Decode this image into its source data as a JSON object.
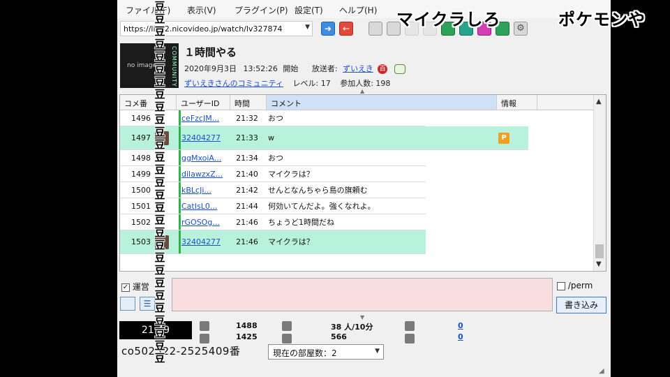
{
  "menu": [
    "ファイル(F)",
    "表示(V)",
    "プラグイン(P)",
    "設定(T)",
    "ヘルプ(H)"
  ],
  "url": "https://live2.nicovideo.jp/watch/lv327874",
  "thumbnail": {
    "text": "no image",
    "side": "COMMUNITY"
  },
  "broadcast": {
    "title": "１時間やる",
    "date": "2020年9月3日",
    "start_time": "13:52:26",
    "start_label": "開始",
    "broadcaster_label": "放送者:",
    "broadcaster": "ずいえき",
    "community": "ずいえきさんのコミュニティ",
    "level": "レベル: 17",
    "participants": "参加人数: 198"
  },
  "table": {
    "headers": [
      "コメ番",
      "ユーザーID",
      "時間",
      "コメント",
      "情報"
    ],
    "rows": [
      {
        "no": "1496",
        "uid": "ceFzcJM...",
        "time": "21:32",
        "comment": "おつ"
      },
      {
        "no": "1497",
        "uid": "32404277",
        "time": "21:33",
        "comment": "w",
        "badge": "P"
      },
      {
        "no": "1498",
        "uid": "ggMxoiA...",
        "time": "21:34",
        "comment": "おつ"
      },
      {
        "no": "1499",
        "uid": "dilawzxZ...",
        "time": "21:40",
        "comment": "マイクラは？"
      },
      {
        "no": "1500",
        "uid": "kBLcJi...",
        "time": "21:42",
        "comment": "せんとなんちゃら島の旗頼む"
      },
      {
        "no": "1501",
        "uid": "CatIsL0...",
        "time": "21:44",
        "comment": "何効いてんだよ。強くなれよ。"
      },
      {
        "no": "1502",
        "uid": "rGOSOg...",
        "time": "21:46",
        "comment": "ちょうど1時間だね"
      },
      {
        "no": "1503",
        "uid": "32404277",
        "time": "21:46",
        "comment": "マイクラは？"
      }
    ]
  },
  "post": {
    "unei_label": "運営",
    "perm_label": "/perm",
    "write_button": "書き込み"
  },
  "status": {
    "clock": "21:49",
    "comments_total": "1488",
    "comments_sub": "1425",
    "per10min": "38 人/10分",
    "active": "566",
    "link_a": "0",
    "link_b": "0",
    "community_id": "co502322-2525409番",
    "room_select": "現在の部屋数：2"
  },
  "overlay": {
    "vertical_char": "豆",
    "right_text_1": "マイクラしろ",
    "right_text_2": "ポケモンや"
  },
  "colors": {
    "highlight_row": "#b8f2dc",
    "input_bg": "#f8dede",
    "accent_link": "#1a4fd0"
  }
}
